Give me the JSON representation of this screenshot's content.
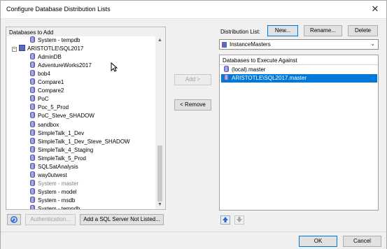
{
  "window": {
    "title": "Configure Database Distribution Lists"
  },
  "left": {
    "header": "Databases to Add",
    "tree": [
      {
        "label": "System - tempdb",
        "type": "db",
        "indent": 2,
        "gray": false
      },
      {
        "label": "ARISTOTLE\\SQL2017",
        "type": "server",
        "indent": 0,
        "gray": false
      },
      {
        "label": "AdminDB",
        "type": "db",
        "indent": 2,
        "gray": false
      },
      {
        "label": "AdventureWorks2017",
        "type": "db",
        "indent": 2,
        "gray": false
      },
      {
        "label": "bob4",
        "type": "db",
        "indent": 2,
        "gray": false
      },
      {
        "label": "Compare1",
        "type": "db",
        "indent": 2,
        "gray": false
      },
      {
        "label": "Compare2",
        "type": "db",
        "indent": 2,
        "gray": false
      },
      {
        "label": "PoC",
        "type": "db",
        "indent": 2,
        "gray": false
      },
      {
        "label": "Poc_5_Prod",
        "type": "db",
        "indent": 2,
        "gray": false
      },
      {
        "label": "PoC_Steve_SHADOW",
        "type": "db",
        "indent": 2,
        "gray": false
      },
      {
        "label": "sandbox",
        "type": "db",
        "indent": 2,
        "gray": false
      },
      {
        "label": "SimpleTalk_1_Dev",
        "type": "db",
        "indent": 2,
        "gray": false
      },
      {
        "label": "SimpleTalk_1_Dev_Steve_SHADOW",
        "type": "db",
        "indent": 2,
        "gray": false
      },
      {
        "label": "SimpleTalk_4_Staging",
        "type": "db",
        "indent": 2,
        "gray": false
      },
      {
        "label": "SimpleTalk_5_Prod",
        "type": "db",
        "indent": 2,
        "gray": false
      },
      {
        "label": "SQLSatAnalysis",
        "type": "db",
        "indent": 2,
        "gray": false
      },
      {
        "label": "way0utwest",
        "type": "db",
        "indent": 2,
        "gray": false
      },
      {
        "label": "System - master",
        "type": "db",
        "indent": 2,
        "gray": true
      },
      {
        "label": "System - model",
        "type": "db",
        "indent": 2,
        "gray": false
      },
      {
        "label": "System - msdb",
        "type": "db",
        "indent": 2,
        "gray": false
      },
      {
        "label": "System - tempdb",
        "type": "db",
        "indent": 2,
        "gray": false
      }
    ],
    "authentication_label": "Authentication...",
    "add_server_label": "Add a SQL Server Not Listed..."
  },
  "middle": {
    "add_label": "Add >",
    "remove_label": "< Remove"
  },
  "right": {
    "distribution_list_label": "Distribution List:",
    "new_label": "New...",
    "rename_label": "Rename...",
    "delete_label": "Delete",
    "selected_list": "InstanceMasters",
    "header": "Databases to Execute Against",
    "items": [
      {
        "label": "(local).master",
        "selected": false
      },
      {
        "label": "ARISTOTLE\\SQL2017.master",
        "selected": true
      }
    ]
  },
  "footer": {
    "ok_label": "OK",
    "cancel_label": "Cancel"
  },
  "colors": {
    "accent": "#0078d7",
    "selection": "#0078d7"
  }
}
